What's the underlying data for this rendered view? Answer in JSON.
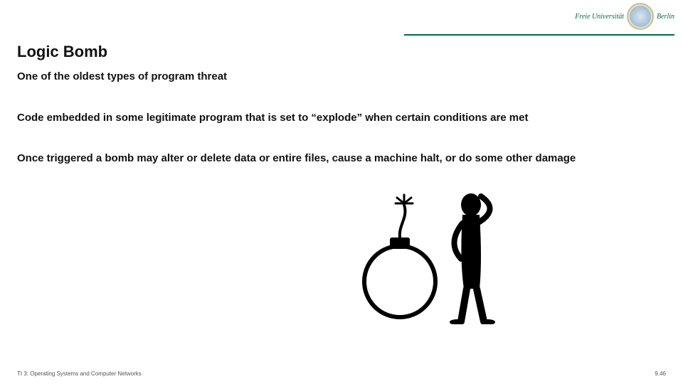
{
  "header": {
    "institution_left": "Freie Universität",
    "institution_right": "Berlin"
  },
  "slide": {
    "title": "Logic Bomb",
    "bullets": [
      "One of the oldest types of program threat",
      "Code embedded in some legitimate program that is set to “explode” when certain conditions are met",
      "Once triggered a bomb may alter or delete data or entire files, cause a machine halt, or do some other damage"
    ]
  },
  "footer": {
    "left": "TI 3: Operating Systems and Computer Networks",
    "right": "9.46"
  },
  "illustration": {
    "name": "bomb-and-person-illustration"
  }
}
